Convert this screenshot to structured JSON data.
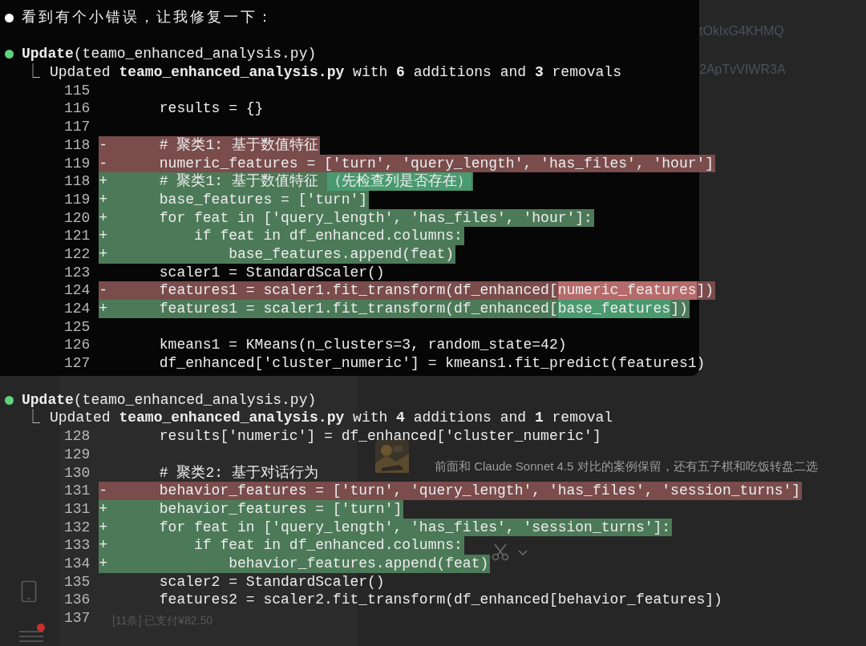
{
  "background_chat": {
    "link_fragments": [
      "tOklxG4KHMQ",
      "2ApTvVIWR3A"
    ],
    "message": {
      "kind": "picture",
      "text": "前面和 Claude Sonnet 4.5 对比的案例保留，还有五子棋和吃饭转盘二选"
    },
    "list_preview": "[11条] 已支付¥82.50",
    "notification": true
  },
  "terminal": {
    "messages": [
      {
        "kind": "text",
        "color": "#ffffff",
        "text": "看到有个小错误，让我修复一下："
      },
      {
        "kind": "tool",
        "color": "#5fd47a",
        "call": "**Update**(teamo_enhanced_analysis.py)",
        "result_mark": "⎿",
        "result": "Updated **teamo_enhanced_analysis.py** with **6** additions and **3** removals",
        "lines": [
          {
            "number": "115"
          },
          {
            "number": "116",
            "kind": "context",
            "code": "results = {}"
          },
          {
            "number": "117"
          },
          {
            "number": "118",
            "kind": "removed",
            "marker": "-",
            "code": "# 聚类1: 基于数值特征"
          },
          {
            "number": "119",
            "kind": "removed",
            "marker": "-",
            "code": "numeric_features = ['turn', 'query_length', 'has_files', 'hour']"
          },
          {
            "number": "118",
            "kind": "added",
            "marker": "+",
            "segments": [
              {
                "text": "# 聚类1: 基于数值特征 ",
                "emphasis": false
              },
              {
                "text": "（先检查列是否存在）",
                "emphasis": true
              }
            ]
          },
          {
            "number": "119",
            "kind": "added",
            "marker": "+",
            "code": "base_features = ['turn']"
          },
          {
            "number": "120",
            "kind": "added",
            "marker": "+",
            "code": "for feat in ['query_length', 'has_files', 'hour']:"
          },
          {
            "number": "121",
            "kind": "added",
            "marker": "+",
            "code": "    if feat in df_enhanced.columns:"
          },
          {
            "number": "122",
            "kind": "added",
            "marker": "+",
            "code": "        base_features.append(feat)"
          },
          {
            "number": "123",
            "kind": "context",
            "code": "scaler1 = StandardScaler()"
          },
          {
            "number": "124",
            "kind": "removed",
            "marker": "-",
            "segments": [
              {
                "text": "features1 = scaler1.fit_transform(df_enhanced[",
                "emphasis": false
              },
              {
                "text": "numeric_features",
                "emphasis": true
              },
              {
                "text": "])",
                "emphasis": false
              }
            ]
          },
          {
            "number": "124",
            "kind": "added",
            "marker": "+",
            "segments": [
              {
                "text": "features1 = scaler1.fit_transform(df_enhanced[",
                "emphasis": false
              },
              {
                "text": "base_features",
                "emphasis": true
              },
              {
                "text": "])",
                "emphasis": false
              }
            ]
          },
          {
            "number": "125"
          },
          {
            "number": "126",
            "kind": "context",
            "code": "kmeans1 = KMeans(n_clusters=3, random_state=42)"
          },
          {
            "number": "127",
            "kind": "context",
            "code": "df_enhanced['cluster_numeric'] = kmeans1.fit_predict(features1)"
          }
        ]
      }
    ]
  },
  "continued_output": {
    "messages": [
      {
        "kind": "tool",
        "color": "#5fd47a",
        "call": "**Update**(teamo_enhanced_analysis.py)",
        "result_mark": "⎿",
        "result": "Updated **teamo_enhanced_analysis.py** with **4** additions and **1** removal",
        "lines": [
          {
            "number": "128",
            "kind": "context",
            "code": "results['numeric'] = df_enhanced['cluster_numeric']"
          },
          {
            "number": "129"
          },
          {
            "number": "130",
            "kind": "context",
            "code": "# 聚类2: 基于对话行为"
          },
          {
            "number": "131",
            "kind": "removed",
            "marker": "-",
            "code": "behavior_features = ['turn', 'query_length', 'has_files', 'session_turns']"
          },
          {
            "number": "131",
            "kind": "added",
            "marker": "+",
            "code": "behavior_features = ['turn']"
          },
          {
            "number": "132",
            "kind": "added",
            "marker": "+",
            "code": "for feat in ['query_length', 'has_files', 'session_turns']:"
          },
          {
            "number": "133",
            "kind": "added",
            "marker": "+",
            "code": "    if feat in df_enhanced.columns:"
          },
          {
            "number": "134",
            "kind": "added",
            "marker": "+",
            "code": "        behavior_features.append(feat)"
          },
          {
            "number": "135",
            "kind": "context",
            "code": "scaler2 = StandardScaler()"
          },
          {
            "number": "136",
            "kind": "context",
            "code": "features2 = scaler2.fit_transform(df_enhanced[behavior_features])"
          },
          {
            "number": "137"
          }
        ]
      }
    ]
  }
}
